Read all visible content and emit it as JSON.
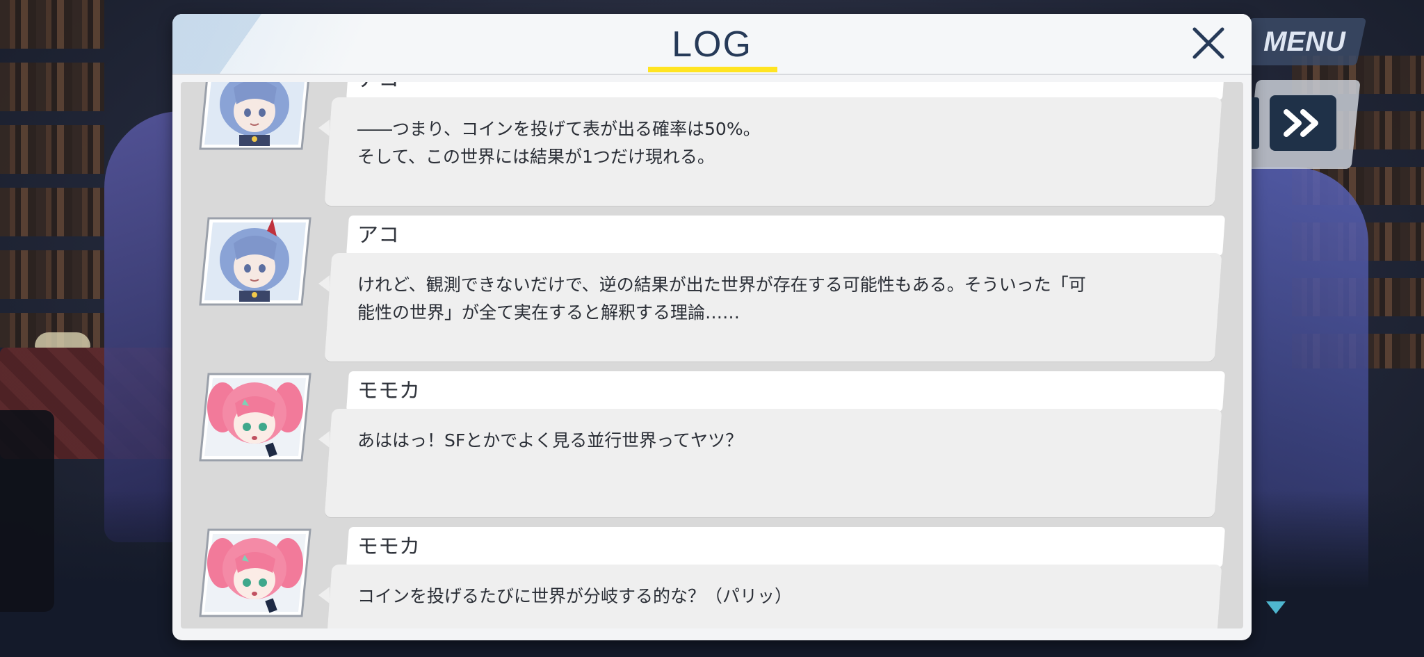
{
  "header": {
    "title": "LOG"
  },
  "hud": {
    "menu_label": "MENU"
  },
  "entries": [
    {
      "speaker": "アコ",
      "text": "――つまり、コインを投げて表が出る確率は50%。\nそして、この世界には結果が1つだけ現れる。",
      "portrait": "ako"
    },
    {
      "speaker": "アコ",
      "text": "けれど、観測できないだけで、逆の結果が出た世界が存在する可能性もある。そういった「可\n能性の世界」が全て実在すると解釈する理論……",
      "portrait": "ako"
    },
    {
      "speaker": "モモカ",
      "text": "あははっ！SFとかでよく見る並行世界ってヤツ？",
      "portrait": "momoka"
    },
    {
      "speaker": "モモカ",
      "text": "コインを投げるたびに世界が分岐する的な？（パリッ）",
      "portrait": "momoka"
    }
  ],
  "colors": {
    "accent_underline": "#ffe422",
    "title_text": "#263a58",
    "ako_hair": "#8aa3d6",
    "momoka_hair": "#f27a9a"
  },
  "icons": {
    "close": "close-icon",
    "fast_forward": "fast-forward-icon",
    "scroll_down": "scroll-down-icon"
  }
}
